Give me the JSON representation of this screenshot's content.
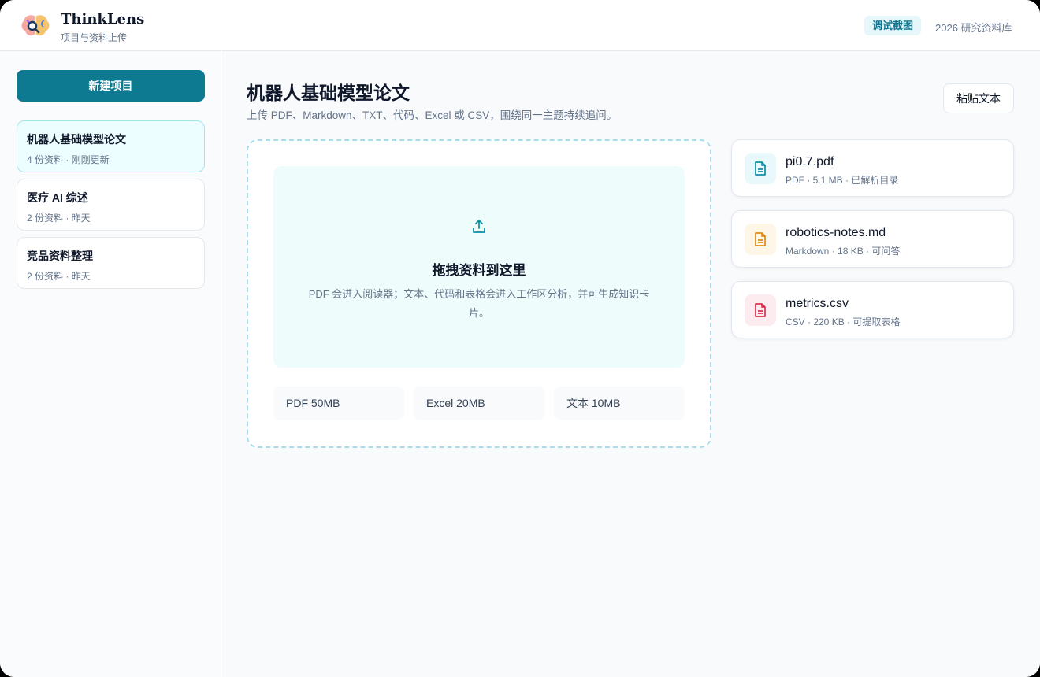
{
  "header": {
    "brand_title": "ThinkLens",
    "brand_subtitle": "项目与资料上传",
    "debug_badge": "调试截图",
    "library_label": "2026 研究资料库"
  },
  "sidebar": {
    "new_project_label": "新建项目",
    "projects": [
      {
        "name": "机器人基础模型论文",
        "meta": "4 份资料 · 刚刚更新",
        "active": true
      },
      {
        "name": "医疗 AI 综述",
        "meta": "2 份资料 · 昨天",
        "active": false
      },
      {
        "name": "竞品资料整理",
        "meta": "2 份资料 · 昨天",
        "active": false
      }
    ]
  },
  "main": {
    "title": "机器人基础模型论文",
    "subtitle": "上传 PDF、Markdown、TXT、代码、Excel 或 CSV，围绕同一主题持续追问。",
    "paste_button": "粘贴文本",
    "dropzone": {
      "icon": "upload-icon",
      "title": "拖拽资料到这里",
      "description": "PDF 会进入阅读器；文本、代码和表格会进入工作区分析，并可生成知识卡片。",
      "limits": [
        "PDF 50MB",
        "Excel 20MB",
        "文本 10MB"
      ]
    },
    "files": [
      {
        "name": "pi0.7.pdf",
        "meta": "PDF · 5.1 MB · 已解析目录",
        "icon": "document-icon",
        "color": "#0e8fa6",
        "bg": "#e8f8fb"
      },
      {
        "name": "robotics-notes.md",
        "meta": "Markdown · 18 KB · 可问答",
        "icon": "document-icon",
        "color": "#e08a1a",
        "bg": "#fef6e7"
      },
      {
        "name": "metrics.csv",
        "meta": "CSV · 220 KB · 可提取表格",
        "icon": "document-icon",
        "color": "#d9304f",
        "bg": "#fdecef"
      }
    ]
  },
  "colors": {
    "accent": "#0e7a91",
    "active_project_bg": "#ecfeff",
    "dropzone_border": "#a8dcea"
  }
}
